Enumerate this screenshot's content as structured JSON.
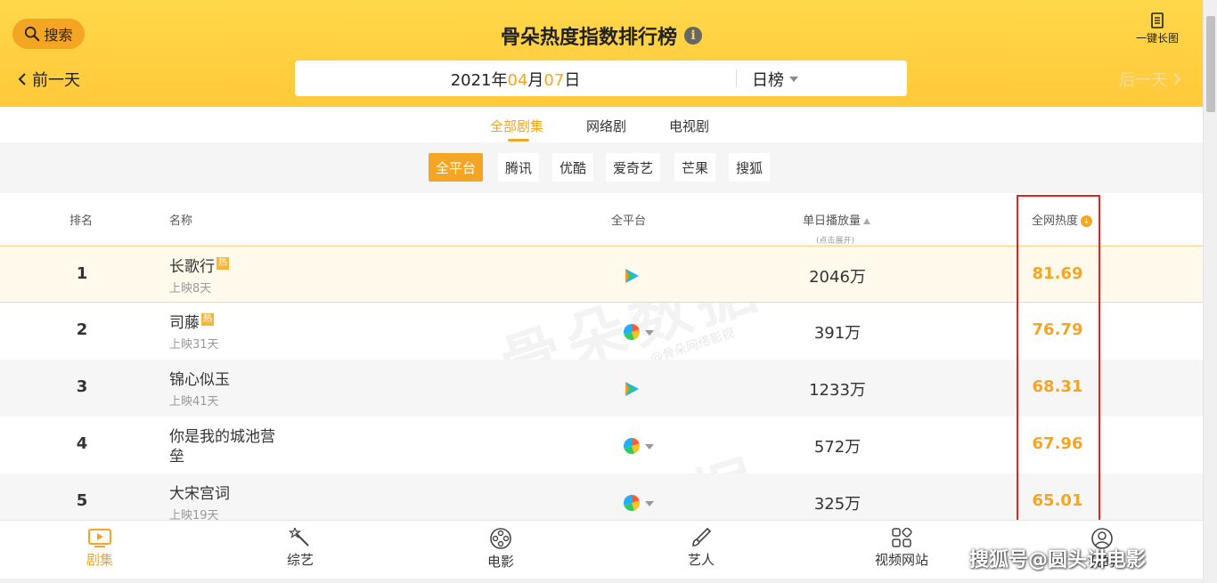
{
  "header": {
    "search_label": "搜索",
    "title": "骨朵热度指数排行榜",
    "longimg_label": "一键长图",
    "prev_day": "前一天",
    "next_day": "后一天",
    "date": {
      "year": "2021",
      "year_unit": "年",
      "month": "04",
      "month_unit": "月",
      "day": "07",
      "day_unit": "日"
    },
    "period": "日榜"
  },
  "tabs": [
    {
      "label": "全部剧集",
      "active": true
    },
    {
      "label": "网络剧",
      "active": false
    },
    {
      "label": "电视剧",
      "active": false
    }
  ],
  "platforms": [
    {
      "label": "全平台",
      "active": true
    },
    {
      "label": "腾讯",
      "active": false
    },
    {
      "label": "优酷",
      "active": false
    },
    {
      "label": "爱奇艺",
      "active": false
    },
    {
      "label": "芒果",
      "active": false
    },
    {
      "label": "搜狐",
      "active": false
    }
  ],
  "table": {
    "headers": {
      "rank": "排名",
      "name": "名称",
      "platform": "全平台",
      "views": "单日播放量",
      "views_sub": "(点击展开)",
      "heat": "全网热度"
    },
    "rows": [
      {
        "rank": "1",
        "name": "长歌行",
        "hot": "热",
        "sub": "上映8天",
        "platform": "tencent",
        "views": "2046万",
        "heat": "81.69"
      },
      {
        "rank": "2",
        "name": "司藤",
        "hot": "热",
        "sub": "上映31天",
        "platform": "multi",
        "views": "391万",
        "heat": "76.79"
      },
      {
        "rank": "3",
        "name": "锦心似玉",
        "hot": "",
        "sub": "上映41天",
        "platform": "tencent",
        "views": "1233万",
        "heat": "68.31"
      },
      {
        "rank": "4",
        "name": "你是我的城池营垒",
        "hot": "",
        "sub": "",
        "platform": "multi",
        "views": "572万",
        "heat": "67.96"
      },
      {
        "rank": "5",
        "name": "大宋宫词",
        "hot": "",
        "sub": "上映19天",
        "platform": "multi",
        "views": "325万",
        "heat": "65.01"
      }
    ]
  },
  "watermark": {
    "text": "骨朵数据",
    "sub": "@骨朵网络影视"
  },
  "bottom_nav": [
    {
      "label": "剧集",
      "icon": "tv-play-icon",
      "active": true
    },
    {
      "label": "综艺",
      "icon": "magic-wand-icon",
      "active": false
    },
    {
      "label": "电影",
      "icon": "film-reel-icon",
      "active": false
    },
    {
      "label": "艺人",
      "icon": "brush-icon",
      "active": false
    },
    {
      "label": "视频网站",
      "icon": "apps-grid-icon",
      "active": false
    },
    {
      "label": "我的",
      "icon": "user-icon",
      "active": false
    }
  ],
  "credit": "搜狐号@圆头讲电影",
  "colors": {
    "accent": "#f5a524",
    "header_bg": "#ffd84a",
    "highlight_box": "#e32222"
  }
}
